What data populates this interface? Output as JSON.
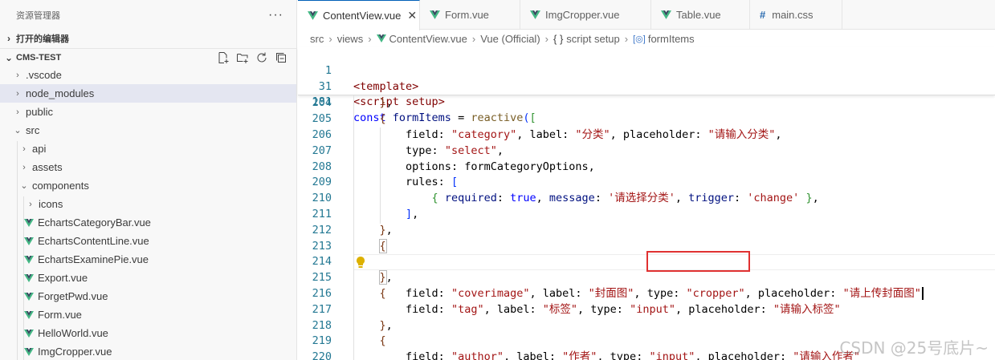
{
  "sidebar": {
    "title": "资源管理器",
    "more": "···",
    "open_editors": "打开的编辑器",
    "project": "CMS-TEST",
    "tree": [
      {
        "label": ".vscode",
        "type": "folder",
        "depth": 1
      },
      {
        "label": "node_modules",
        "type": "folder",
        "depth": 1
      },
      {
        "label": "public",
        "type": "folder",
        "depth": 1
      },
      {
        "label": "src",
        "type": "folder-open",
        "depth": 1
      },
      {
        "label": "api",
        "type": "folder",
        "depth": 2
      },
      {
        "label": "assets",
        "type": "folder",
        "depth": 2
      },
      {
        "label": "components",
        "type": "folder-open",
        "depth": 2
      },
      {
        "label": "icons",
        "type": "folder",
        "depth": 3
      },
      {
        "label": "EchartsCategoryBar.vue",
        "type": "vue",
        "depth": 3
      },
      {
        "label": "EchartsContentLine.vue",
        "type": "vue",
        "depth": 3
      },
      {
        "label": "EchartsExaminePie.vue",
        "type": "vue",
        "depth": 3
      },
      {
        "label": "Export.vue",
        "type": "vue",
        "depth": 3
      },
      {
        "label": "ForgetPwd.vue",
        "type": "vue",
        "depth": 3
      },
      {
        "label": "Form.vue",
        "type": "vue",
        "depth": 3
      },
      {
        "label": "HelloWorld.vue",
        "type": "vue",
        "depth": 3
      },
      {
        "label": "ImgCropper.vue",
        "type": "vue",
        "depth": 3
      }
    ]
  },
  "tabs": [
    {
      "label": "ContentView.vue",
      "icon": "vue-icon",
      "active": true
    },
    {
      "label": "Form.vue",
      "icon": "vue-icon"
    },
    {
      "label": "ImgCropper.vue",
      "icon": "vue-icon"
    },
    {
      "label": "Table.vue",
      "icon": "vue-icon"
    },
    {
      "label": "main.css",
      "icon": "css-hash-icon"
    }
  ],
  "breadcrumb": {
    "p0": "src",
    "p1": "views",
    "p2": "ContentView.vue",
    "p3": "Vue (Official)",
    "p4_icon": "{ }",
    "p4": "script setup",
    "p5_icon": "[◎]",
    "p5": "formItems"
  },
  "sticky": [
    {
      "n": "1"
    },
    {
      "n": "31"
    },
    {
      "n": "181"
    }
  ],
  "lines": [
    {
      "n": "204"
    },
    {
      "n": "205"
    },
    {
      "n": "206"
    },
    {
      "n": "207"
    },
    {
      "n": "208"
    },
    {
      "n": "209"
    },
    {
      "n": "210"
    },
    {
      "n": "211"
    },
    {
      "n": "212"
    },
    {
      "n": "213"
    },
    {
      "n": "214"
    },
    {
      "n": "215"
    },
    {
      "n": "216"
    },
    {
      "n": "217"
    },
    {
      "n": "218"
    },
    {
      "n": "219"
    },
    {
      "n": "220"
    }
  ],
  "code": {
    "field": "field",
    "label": "label",
    "placeholder": "placeholder",
    "type": "type",
    "options": "options",
    "rules": "rules",
    "required": "required",
    "true": "true",
    "message": "message",
    "trigger": "trigger",
    "template_open": "<template>",
    "script_open_a": "<script",
    "script_open_b": "setup",
    "script_open_c": ">",
    "const": "const",
    "formItems": "formItems",
    "reactive": "reactive",
    "s_category": "\"category\"",
    "s_fenlei": "\"分类\"",
    "s_qingshuru_fenlei": "\"请输入分类\"",
    "s_select": "\"select\"",
    "formCategoryOptions": "formCategoryOptions",
    "s_qingxuanze": "'请选择分类'",
    "s_change": "'change'",
    "s_coverimage": "\"coverimage\"",
    "s_fengmiantu": "\"封面图\"",
    "s_cropper": "\"cropper\"",
    "s_shangchuan": "\"请上传封面图\"",
    "s_tag": "\"tag\"",
    "s_biaoqian": "\"标签\"",
    "s_input": "\"input\"",
    "s_qingshuru_biaoqian": "\"请输入标签\"",
    "s_author": "\"author\"",
    "s_zuozhe": "\"作者\"",
    "s_qingshuru_zuozhe": "\"请输入作者\""
  },
  "watermark": "CSDN @25号底片~",
  "colors": {
    "accent": "#005fb8",
    "vue_green": "#41b883",
    "highlight_red": "#e03131"
  }
}
